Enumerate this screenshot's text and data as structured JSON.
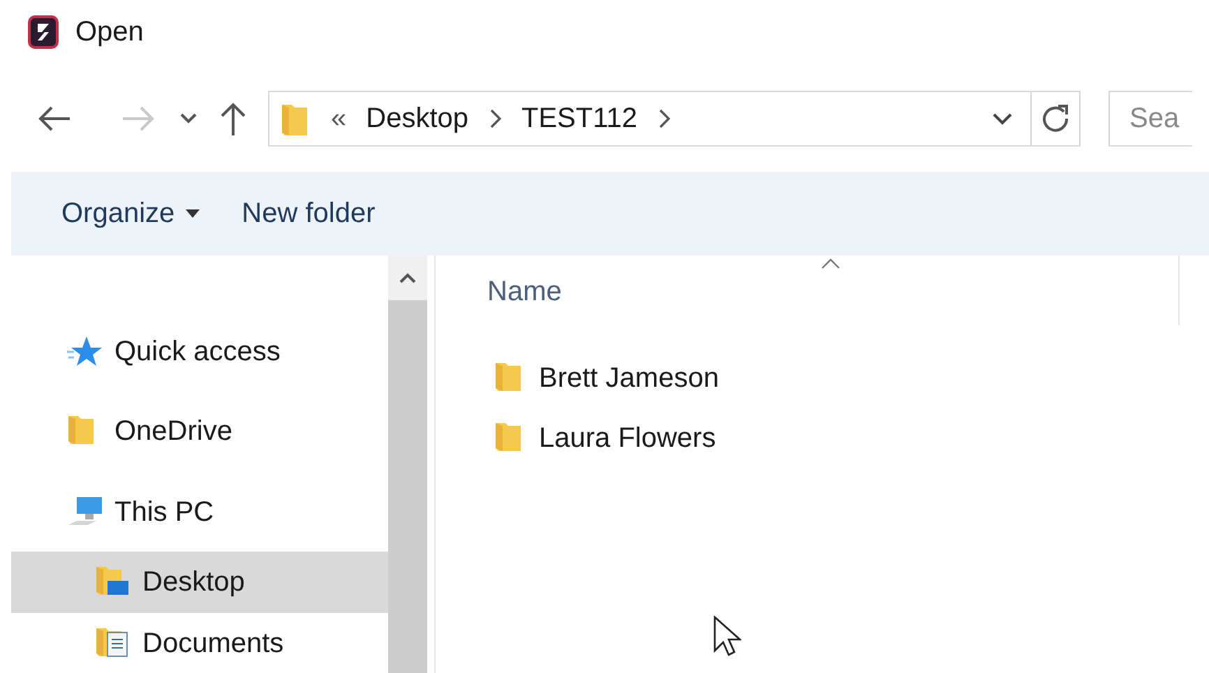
{
  "window": {
    "title": "Open"
  },
  "address": {
    "segments": [
      "«",
      "Desktop",
      "TEST112"
    ]
  },
  "search": {
    "placeholder": "Sea"
  },
  "toolbar": {
    "buttons": [
      {
        "label": "Organize",
        "dropdown": true
      },
      {
        "label": "New folder",
        "dropdown": false
      }
    ]
  },
  "sidebar": {
    "items": [
      {
        "label": "Quick access",
        "kind": "star",
        "selected": false
      },
      {
        "label": "OneDrive",
        "kind": "folder",
        "selected": false
      },
      {
        "label": "This PC",
        "kind": "pc",
        "selected": false,
        "children": [
          {
            "label": "Desktop",
            "kind": "desktop",
            "selected": true
          },
          {
            "label": "Documents",
            "kind": "documents",
            "selected": false
          }
        ]
      }
    ]
  },
  "file_list": {
    "columns": [
      "Name"
    ],
    "rows": [
      {
        "name": "Brett Jameson"
      },
      {
        "name": "Laura Flowers"
      }
    ]
  }
}
